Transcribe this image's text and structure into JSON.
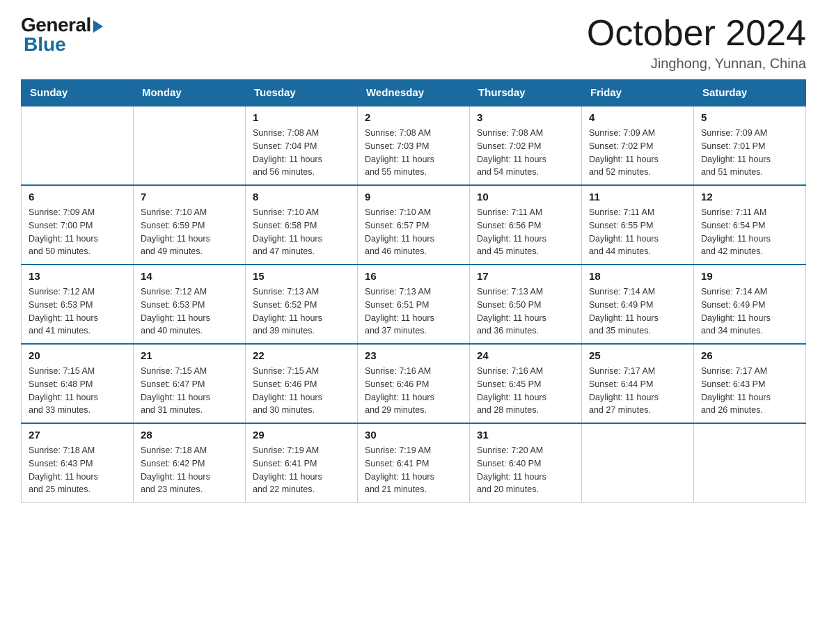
{
  "logo": {
    "general": "General",
    "blue": "Blue"
  },
  "header": {
    "month": "October 2024",
    "location": "Jinghong, Yunnan, China"
  },
  "days_of_week": [
    "Sunday",
    "Monday",
    "Tuesday",
    "Wednesday",
    "Thursday",
    "Friday",
    "Saturday"
  ],
  "weeks": [
    [
      {
        "day": "",
        "info": ""
      },
      {
        "day": "",
        "info": ""
      },
      {
        "day": "1",
        "info": "Sunrise: 7:08 AM\nSunset: 7:04 PM\nDaylight: 11 hours\nand 56 minutes."
      },
      {
        "day": "2",
        "info": "Sunrise: 7:08 AM\nSunset: 7:03 PM\nDaylight: 11 hours\nand 55 minutes."
      },
      {
        "day": "3",
        "info": "Sunrise: 7:08 AM\nSunset: 7:02 PM\nDaylight: 11 hours\nand 54 minutes."
      },
      {
        "day": "4",
        "info": "Sunrise: 7:09 AM\nSunset: 7:02 PM\nDaylight: 11 hours\nand 52 minutes."
      },
      {
        "day": "5",
        "info": "Sunrise: 7:09 AM\nSunset: 7:01 PM\nDaylight: 11 hours\nand 51 minutes."
      }
    ],
    [
      {
        "day": "6",
        "info": "Sunrise: 7:09 AM\nSunset: 7:00 PM\nDaylight: 11 hours\nand 50 minutes."
      },
      {
        "day": "7",
        "info": "Sunrise: 7:10 AM\nSunset: 6:59 PM\nDaylight: 11 hours\nand 49 minutes."
      },
      {
        "day": "8",
        "info": "Sunrise: 7:10 AM\nSunset: 6:58 PM\nDaylight: 11 hours\nand 47 minutes."
      },
      {
        "day": "9",
        "info": "Sunrise: 7:10 AM\nSunset: 6:57 PM\nDaylight: 11 hours\nand 46 minutes."
      },
      {
        "day": "10",
        "info": "Sunrise: 7:11 AM\nSunset: 6:56 PM\nDaylight: 11 hours\nand 45 minutes."
      },
      {
        "day": "11",
        "info": "Sunrise: 7:11 AM\nSunset: 6:55 PM\nDaylight: 11 hours\nand 44 minutes."
      },
      {
        "day": "12",
        "info": "Sunrise: 7:11 AM\nSunset: 6:54 PM\nDaylight: 11 hours\nand 42 minutes."
      }
    ],
    [
      {
        "day": "13",
        "info": "Sunrise: 7:12 AM\nSunset: 6:53 PM\nDaylight: 11 hours\nand 41 minutes."
      },
      {
        "day": "14",
        "info": "Sunrise: 7:12 AM\nSunset: 6:53 PM\nDaylight: 11 hours\nand 40 minutes."
      },
      {
        "day": "15",
        "info": "Sunrise: 7:13 AM\nSunset: 6:52 PM\nDaylight: 11 hours\nand 39 minutes."
      },
      {
        "day": "16",
        "info": "Sunrise: 7:13 AM\nSunset: 6:51 PM\nDaylight: 11 hours\nand 37 minutes."
      },
      {
        "day": "17",
        "info": "Sunrise: 7:13 AM\nSunset: 6:50 PM\nDaylight: 11 hours\nand 36 minutes."
      },
      {
        "day": "18",
        "info": "Sunrise: 7:14 AM\nSunset: 6:49 PM\nDaylight: 11 hours\nand 35 minutes."
      },
      {
        "day": "19",
        "info": "Sunrise: 7:14 AM\nSunset: 6:49 PM\nDaylight: 11 hours\nand 34 minutes."
      }
    ],
    [
      {
        "day": "20",
        "info": "Sunrise: 7:15 AM\nSunset: 6:48 PM\nDaylight: 11 hours\nand 33 minutes."
      },
      {
        "day": "21",
        "info": "Sunrise: 7:15 AM\nSunset: 6:47 PM\nDaylight: 11 hours\nand 31 minutes."
      },
      {
        "day": "22",
        "info": "Sunrise: 7:15 AM\nSunset: 6:46 PM\nDaylight: 11 hours\nand 30 minutes."
      },
      {
        "day": "23",
        "info": "Sunrise: 7:16 AM\nSunset: 6:46 PM\nDaylight: 11 hours\nand 29 minutes."
      },
      {
        "day": "24",
        "info": "Sunrise: 7:16 AM\nSunset: 6:45 PM\nDaylight: 11 hours\nand 28 minutes."
      },
      {
        "day": "25",
        "info": "Sunrise: 7:17 AM\nSunset: 6:44 PM\nDaylight: 11 hours\nand 27 minutes."
      },
      {
        "day": "26",
        "info": "Sunrise: 7:17 AM\nSunset: 6:43 PM\nDaylight: 11 hours\nand 26 minutes."
      }
    ],
    [
      {
        "day": "27",
        "info": "Sunrise: 7:18 AM\nSunset: 6:43 PM\nDaylight: 11 hours\nand 25 minutes."
      },
      {
        "day": "28",
        "info": "Sunrise: 7:18 AM\nSunset: 6:42 PM\nDaylight: 11 hours\nand 23 minutes."
      },
      {
        "day": "29",
        "info": "Sunrise: 7:19 AM\nSunset: 6:41 PM\nDaylight: 11 hours\nand 22 minutes."
      },
      {
        "day": "30",
        "info": "Sunrise: 7:19 AM\nSunset: 6:41 PM\nDaylight: 11 hours\nand 21 minutes."
      },
      {
        "day": "31",
        "info": "Sunrise: 7:20 AM\nSunset: 6:40 PM\nDaylight: 11 hours\nand 20 minutes."
      },
      {
        "day": "",
        "info": ""
      },
      {
        "day": "",
        "info": ""
      }
    ]
  ]
}
